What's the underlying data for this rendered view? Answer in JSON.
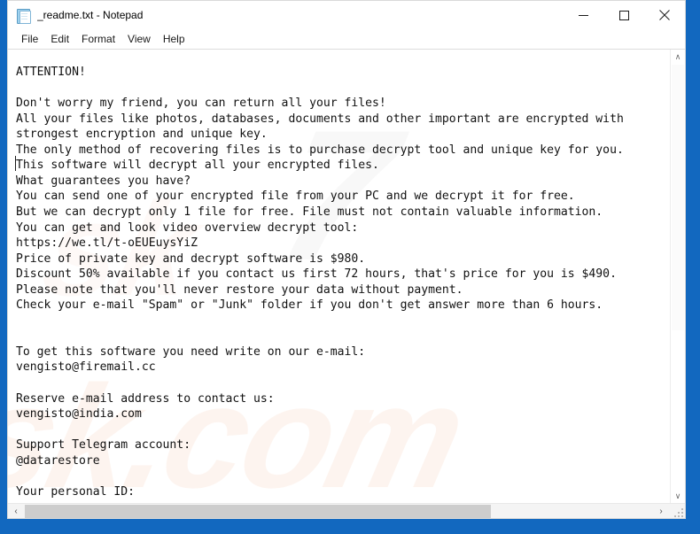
{
  "window": {
    "title": "_readme.txt - Notepad",
    "icon": "notepad-icon",
    "frame_color": "#1268bf",
    "background_color": "#ffffff"
  },
  "caption_buttons": {
    "minimize": "Minimize",
    "maximize": "Maximize",
    "close": "Close"
  },
  "menubar": {
    "items": [
      {
        "label": "File"
      },
      {
        "label": "Edit"
      },
      {
        "label": "Format"
      },
      {
        "label": "View"
      },
      {
        "label": "Help"
      }
    ]
  },
  "document": {
    "text": "ATTENTION!\n\nDon't worry my friend, you can return all your files!\nAll your files like photos, databases, documents and other important are encrypted with\nstrongest encryption and unique key.\nThe only method of recovering files is to purchase decrypt tool and unique key for you.\nThis software will decrypt all your encrypted files.\nWhat guarantees you have?\nYou can send one of your encrypted file from your PC and we decrypt it for free.\nBut we can decrypt only 1 file for free. File must not contain valuable information.\nYou can get and look video overview decrypt tool:\nhttps://we.tl/t-oEUEuysYiZ\nPrice of private key and decrypt software is $980.\nDiscount 50% available if you contact us first 72 hours, that's price for you is $490.\nPlease note that you'll never restore your data without payment.\nCheck your e-mail \"Spam\" or \"Junk\" folder if you don't get answer more than 6 hours.\n\n\nTo get this software you need write on our e-mail:\nvengisto@firemail.cc\n\nReserve e-mail address to contact us:\nvengisto@india.com\n\nSupport Telegram account:\n@datarestore\n\nYour personal ID:\n-",
    "lines": [
      "ATTENTION!",
      "",
      "Don't worry my friend, you can return all your files!",
      "All your files like photos, databases, documents and other important are encrypted with",
      "strongest encryption and unique key.",
      "The only method of recovering files is to purchase decrypt tool and unique key for you.",
      "This software will decrypt all your encrypted files.",
      "What guarantees you have?",
      "You can send one of your encrypted file from your PC and we decrypt it for free.",
      "But we can decrypt only 1 file for free. File must not contain valuable information.",
      "You can get and look video overview decrypt tool:",
      "https://we.tl/t-oEUEuysYiZ",
      "Price of private key and decrypt software is $980.",
      "Discount 50% available if you contact us first 72 hours, that's price for you is $490.",
      "Please note that you'll never restore your data without payment.",
      "Check your e-mail \"Spam\" or \"Junk\" folder if you don't get answer more than 6 hours.",
      "",
      "",
      "To get this software you need write on our e-mail:",
      "vengisto@firemail.cc",
      "",
      "Reserve e-mail address to contact us:",
      "vengisto@india.com",
      "",
      "Support Telegram account:",
      "@datarestore",
      "",
      "Your personal ID:",
      "-"
    ]
  },
  "watermark": {
    "gray_text": "7",
    "orange_text": "sk.com",
    "orange_upper_text": "sk",
    "gray_color": "#78787d",
    "orange_color": "#f0965f"
  },
  "scrollbars": {
    "vertical": {
      "up_arrow": "∧",
      "down_arrow": "∨"
    },
    "horizontal": {
      "left_arrow": "‹",
      "right_arrow": "›"
    }
  }
}
